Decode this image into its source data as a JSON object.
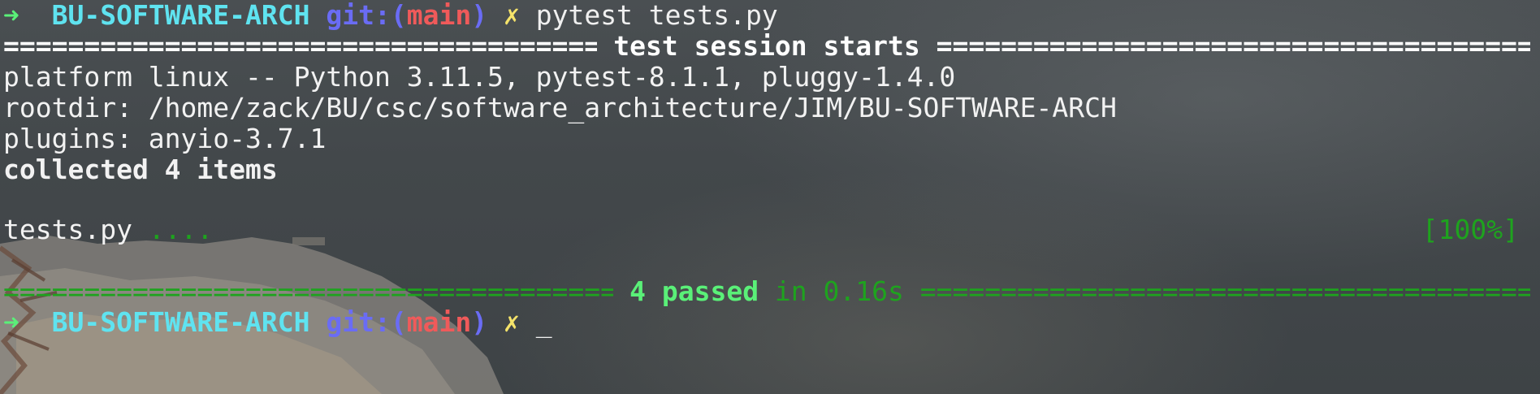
{
  "prompt1": {
    "arrow": "➜",
    "dir": "BU-SOFTWARE-ARCH",
    "git_label": "git:(",
    "branch": "main",
    "git_close": ")",
    "dirty": "✗",
    "command": "pytest tests.py"
  },
  "session_header": {
    "rule_left": "=======================================",
    "title": " test session starts ",
    "rule_right": "==========================================="
  },
  "info": {
    "platform": "platform linux -- Python 3.11.5, pytest-8.1.1, pluggy-1.4.0",
    "rootdir": "rootdir: /home/zack/BU/csc/software_architecture/JIM/BU-SOFTWARE-ARCH",
    "plugins": "plugins: anyio-3.7.1",
    "collected": "collected 4 items"
  },
  "result_line": {
    "file": "tests.py",
    "dots": " ....",
    "percent": "[100%]"
  },
  "summary": {
    "rule_left": "========================================",
    "passed": " 4 passed",
    "time": " in 0.16s ",
    "rule_right": "=========================================="
  },
  "prompt2": {
    "arrow": "➜",
    "dir": "BU-SOFTWARE-ARCH",
    "git_label": "git:(",
    "branch": "main",
    "git_close": ")",
    "dirty": "✗",
    "cursor": "_"
  },
  "colors": {
    "background": "#3f4447",
    "prompt_arrow": "#5af078",
    "directory": "#5fe3f0",
    "git_label": "#6a6cf5",
    "branch": "#f05a5a",
    "dirty_marker": "#f5e36a",
    "pass_green": "#1ea31e"
  }
}
